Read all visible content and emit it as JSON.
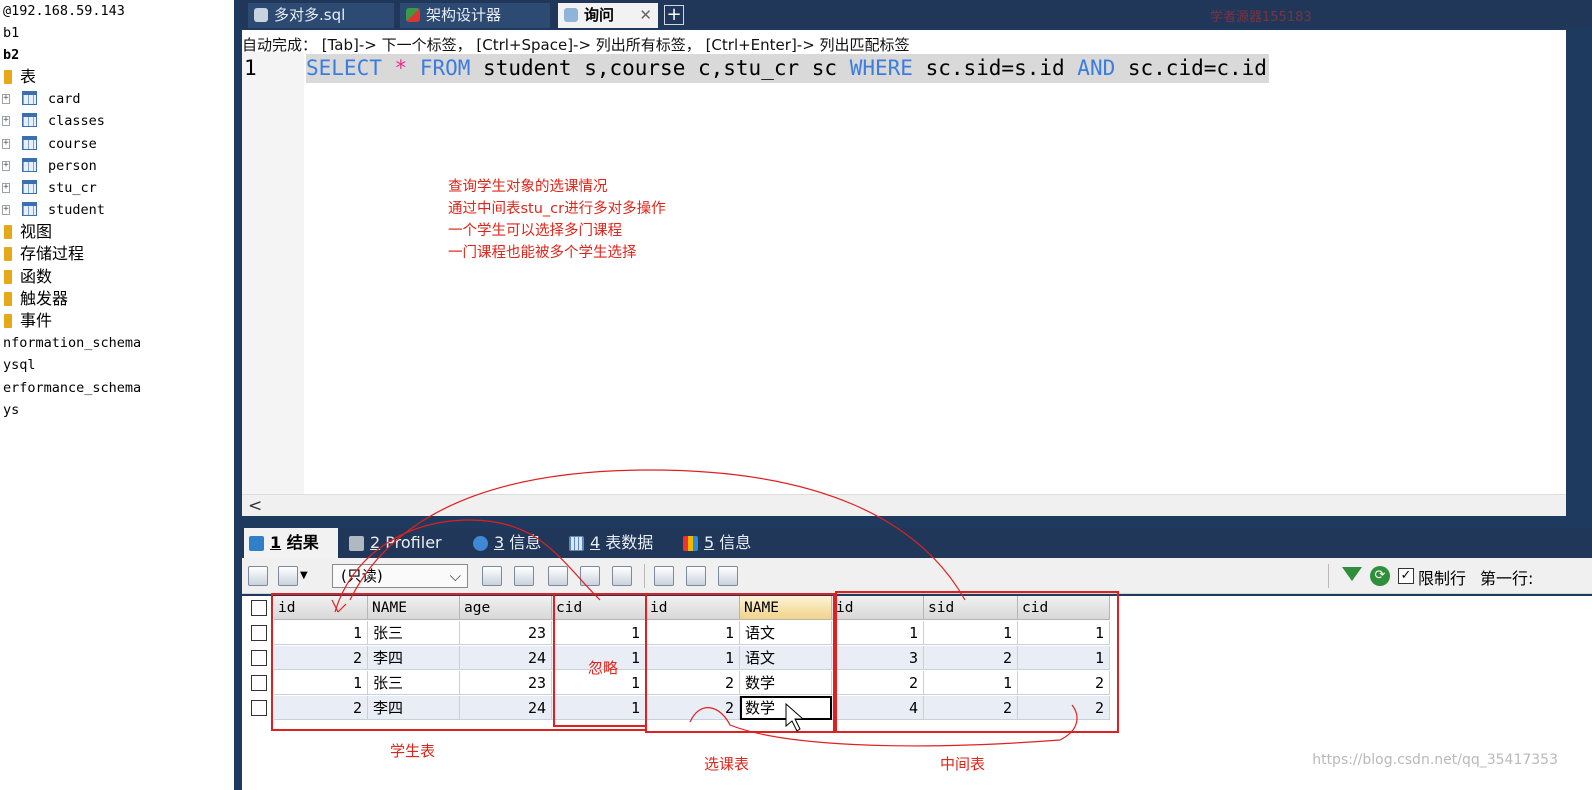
{
  "tree": {
    "items": [
      {
        "label": "@192.168.59.143",
        "kind": "server"
      },
      {
        "label": "b1",
        "kind": "db"
      },
      {
        "label": "b2",
        "kind": "db-bold"
      },
      {
        "label": "表",
        "kind": "folder"
      },
      {
        "label": "card",
        "kind": "table"
      },
      {
        "label": "classes",
        "kind": "table"
      },
      {
        "label": "course",
        "kind": "table"
      },
      {
        "label": "person",
        "kind": "table"
      },
      {
        "label": "stu_cr",
        "kind": "table"
      },
      {
        "label": "student",
        "kind": "table"
      },
      {
        "label": "视图",
        "kind": "folder"
      },
      {
        "label": "存储过程",
        "kind": "folder"
      },
      {
        "label": "函数",
        "kind": "folder"
      },
      {
        "label": "触发器",
        "kind": "folder"
      },
      {
        "label": "事件",
        "kind": "folder"
      },
      {
        "label": "nformation_schema",
        "kind": "db"
      },
      {
        "label": "ysql",
        "kind": "db"
      },
      {
        "label": "erformance_schema",
        "kind": "db"
      },
      {
        "label": "ys",
        "kind": "db"
      }
    ],
    "expander": "⊞"
  },
  "tabs": [
    {
      "label": "多对多.sql",
      "icon": "sql-file-icon"
    },
    {
      "label": "架构设计器",
      "icon": "schema-designer-icon"
    },
    {
      "label": "询问",
      "icon": "query-icon"
    }
  ],
  "tab_close": "✕",
  "tab_add": "+",
  "top_watermark": "学者源器155183",
  "editor": {
    "autocomplete_hint": "自动完成： [Tab]-> 下一个标签， [Ctrl+Space]-> 列出所有标签， [Ctrl+Enter]-> 列出匹配标签",
    "line_number": "1",
    "sql": {
      "select": "SELECT",
      "star": "*",
      "from": "FROM",
      "tables": " student s,course c,stu_cr sc ",
      "where": "WHERE",
      "cond1": " sc.sid=s.id ",
      "and": "AND",
      "cond2": " sc.cid=c.id"
    },
    "annotations": [
      "查询学生对象的选课情况",
      "通过中间表stu_cr进行多对多操作",
      "一个学生可以选择多门课程",
      "一门课程也能被多个学生选择"
    ],
    "scroll_left": "<"
  },
  "result_tabs": [
    {
      "num": "1",
      "label": "结果",
      "icon": "result-icon",
      "active": true
    },
    {
      "num": "2",
      "label": "Profiler",
      "icon": "profiler-icon",
      "active": false
    },
    {
      "num": "3",
      "label": "信息",
      "icon": "info-icon",
      "active": false
    },
    {
      "num": "4",
      "label": "表数据",
      "icon": "table-data-icon",
      "active": false
    },
    {
      "num": "5",
      "label": "信息",
      "icon": "info2-icon",
      "active": false
    }
  ],
  "toolbar": {
    "mode_select": "(只读)",
    "dropdown_arrow": "⌵",
    "limit_checked": "✓",
    "limit_label": "限制行",
    "first_row_label": "第一行:"
  },
  "grid": {
    "columns": [
      "id",
      "NAME",
      "age",
      "cid",
      "id",
      "NAME",
      "id",
      "sid",
      "cid"
    ],
    "rows": [
      [
        "1",
        "张三",
        "23",
        "1",
        "1",
        "语文",
        "1",
        "1",
        "1"
      ],
      [
        "2",
        "李四",
        "24",
        "1",
        "1",
        "语文",
        "3",
        "2",
        "1"
      ],
      [
        "1",
        "张三",
        "23",
        "1",
        "2",
        "数学",
        "2",
        "1",
        "2"
      ],
      [
        "2",
        "李四",
        "24",
        "1",
        "2",
        "数学",
        "4",
        "2",
        "2"
      ]
    ],
    "ignore_label": "忽略",
    "group_labels": {
      "student": "学生表",
      "course": "选课表",
      "middle": "中间表"
    }
  },
  "csdn_watermark": "https://blog.csdn.net/qq_35417353",
  "colors": {
    "accent_red": "#e02020",
    "keyword_blue": "#3b7cdf",
    "star_pink": "#e4308c",
    "panel_navy": "#21375a"
  }
}
